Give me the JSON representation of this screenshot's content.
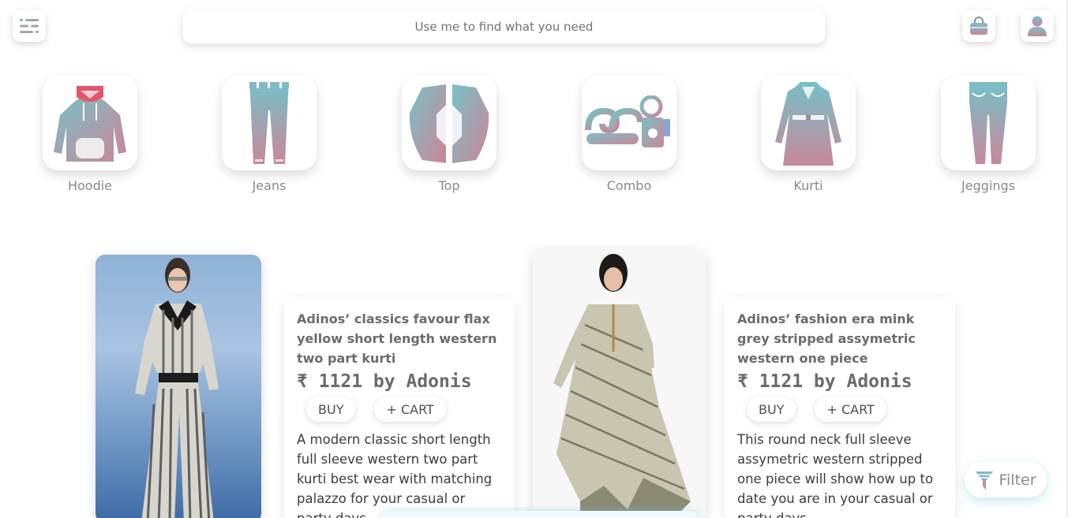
{
  "search": {
    "placeholder": "Use me to find what you need"
  },
  "header_icons": [
    "menu-icon",
    "shopping-bag-icon",
    "user-icon"
  ],
  "categories": [
    {
      "label": "Hoodie",
      "icon": "hoodie-icon"
    },
    {
      "label": "Jeans",
      "icon": "jeans-icon"
    },
    {
      "label": "Top",
      "icon": "top-icon"
    },
    {
      "label": "Combo",
      "icon": "combo-icon"
    },
    {
      "label": "Kurti",
      "icon": "kurti-icon"
    },
    {
      "label": "Jeggings",
      "icon": "jeggings-icon"
    }
  ],
  "products": [
    {
      "title": "Adinos’ classics favour flax yellow short length western two part kurti",
      "price": "₹ 1121 by Adonis",
      "buy_label": "BUY",
      "cart_label": "+ CART",
      "description": "A modern classic short length full sleeve western two part kurti best wear with matching palazzo for your casual or party days."
    },
    {
      "title": "Adinos’ fashion era mink grey stripped assymetric western one piece",
      "price": "₹ 1121 by Adonis",
      "buy_label": "BUY",
      "cart_label": "+ CART",
      "description": "This round neck full sleeve assymetric western stripped one piece will show how up to date you are in your casual or party days."
    }
  ],
  "filter": {
    "label": "Filter",
    "icon": "funnel-icon"
  },
  "colors": {
    "icon_gradient_start": "#7fbcc6",
    "icon_gradient_end": "#c8869a",
    "accent_glow": "#5fc2d8"
  }
}
